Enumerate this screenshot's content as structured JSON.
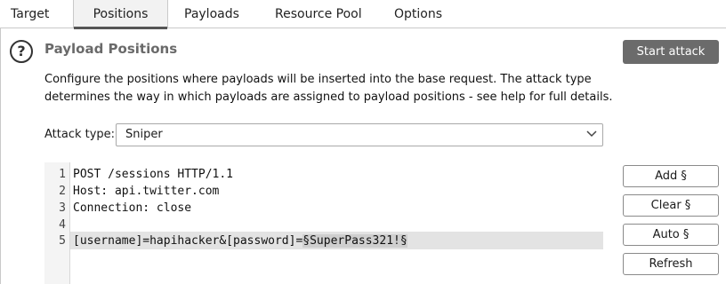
{
  "tabs": [
    {
      "label": "Target"
    },
    {
      "label": "Positions"
    },
    {
      "label": "Payloads"
    },
    {
      "label": "Resource Pool"
    },
    {
      "label": "Options"
    }
  ],
  "section": {
    "title": "Payload Positions",
    "help_glyph": "?",
    "description": "Configure the positions where payloads will be inserted into the base request. The attack type determines the way in which payloads are assigned to payload positions - see help for full details."
  },
  "start_attack_label": "Start attack",
  "attack_type": {
    "label": "Attack type:",
    "value": "Sniper"
  },
  "request": {
    "lines": [
      {
        "num": "1",
        "text": "POST /sessions HTTP/1.1"
      },
      {
        "num": "2",
        "text": "Host: api.twitter.com"
      },
      {
        "num": "3",
        "text": "Connection: close"
      },
      {
        "num": "4",
        "text": ""
      },
      {
        "num": "5",
        "prefix": "[username]=hapihacker&[password]=",
        "marked": "§SuperPass321!§"
      }
    ]
  },
  "side_buttons": {
    "add": "Add §",
    "clear": "Clear §",
    "auto": "Auto §",
    "refresh": "Refresh"
  },
  "colors": {
    "start_button_bg": "#6b6b6b",
    "marker_bg": "#cfcfcf"
  }
}
